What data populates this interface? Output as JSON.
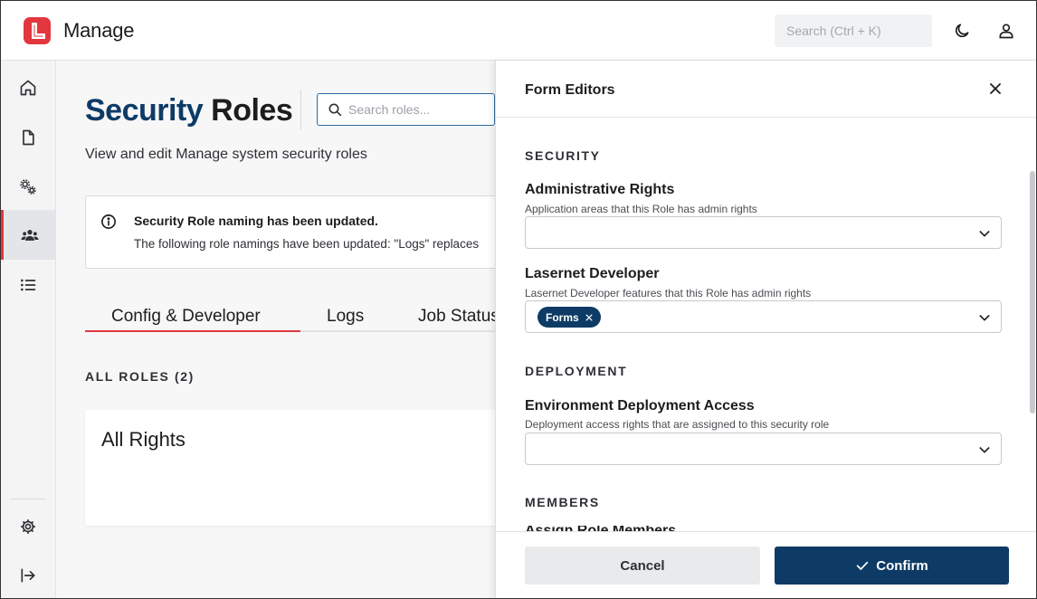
{
  "app": {
    "title": "Manage",
    "search_placeholder": "Search (Ctrl + K)"
  },
  "colors": {
    "brand_red": "#e2373e",
    "navy": "#0d3b66"
  },
  "sidebar": {
    "items": [
      {
        "icon": "home-icon"
      },
      {
        "icon": "document-icon"
      },
      {
        "icon": "cogs-icon"
      },
      {
        "icon": "users-icon",
        "active": true
      },
      {
        "icon": "list-icon"
      }
    ],
    "bottom": [
      {
        "icon": "settings-icon"
      },
      {
        "icon": "expand-icon"
      }
    ]
  },
  "page": {
    "title_part1": "Security",
    "title_part2": "Roles",
    "search_placeholder": "Search roles...",
    "subtitle": "View and edit Manage system security roles",
    "notice": {
      "title": "Security Role naming has been updated.",
      "body": "The following role namings have been updated: \"Logs\" replaces"
    },
    "tabs": [
      "Config & Developer",
      "Logs",
      "Job Status"
    ],
    "active_tab": "Config & Developer",
    "roles_label": "ALL ROLES (2)",
    "role_card_title": "All Rights"
  },
  "drawer": {
    "title": "Form Editors",
    "sections": {
      "security": "SECURITY",
      "deployment": "DEPLOYMENT",
      "members": "MEMBERS"
    },
    "fields": {
      "admin_rights": {
        "label": "Administrative Rights",
        "desc": "Application areas that this Role has admin rights",
        "value": ""
      },
      "lasernet_dev": {
        "label": "Lasernet Developer",
        "desc": "Lasernet Developer features that this Role has admin rights",
        "chip": "Forms"
      },
      "env_deploy": {
        "label": "Environment Deployment Access",
        "desc": "Deployment access rights that are assigned to this security role",
        "value": ""
      }
    },
    "members_peek": "Assign Role Members",
    "cancel_label": "Cancel",
    "confirm_label": "Confirm"
  }
}
